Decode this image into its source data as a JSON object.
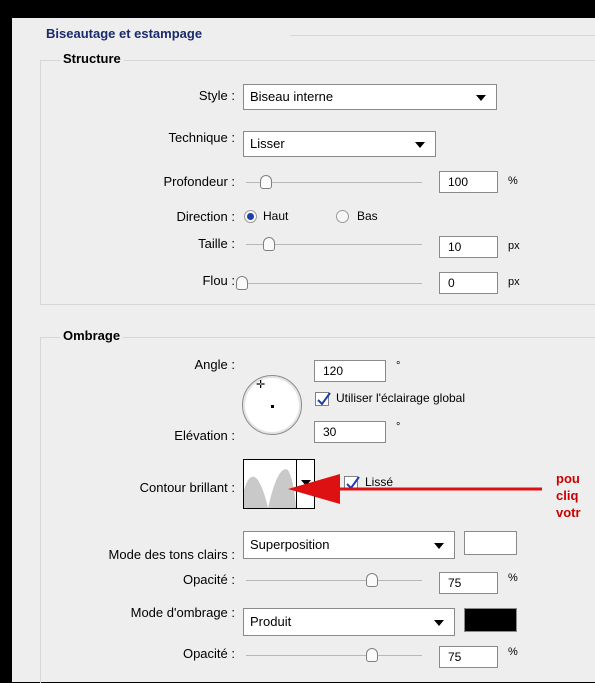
{
  "main_title": "Biseautage et estampage",
  "structure": {
    "title": "Structure",
    "style_label": "Style :",
    "style_value": "Biseau interne",
    "technique_label": "Technique :",
    "technique_value": "Lisser",
    "profondeur_label": "Profondeur :",
    "profondeur_value": "100",
    "profondeur_unit": "%",
    "profondeur_level": 0.08,
    "direction_label": "Direction :",
    "direction_haut": "Haut",
    "direction_bas": "Bas",
    "taille_label": "Taille :",
    "taille_value": "10",
    "taille_unit": "px",
    "taille_level": 0.06,
    "flou_label": "Flou :",
    "flou_value": "0",
    "flou_unit": "px",
    "flou_level": 0.0
  },
  "ombrage": {
    "title": "Ombrage",
    "angle_label": "Angle :",
    "angle_value": "120",
    "angle_unit": "°",
    "global_light_label": "Utiliser l'éclairage global",
    "elevation_label": "Elévation :",
    "elevation_value": "30",
    "elevation_unit": "°",
    "contour_label": "Contour brillant :",
    "lisse_label": "Lissé",
    "mode_clairs_label": "Mode des tons clairs :",
    "mode_clairs_value": "Superposition",
    "highlight_color": "#ffffff",
    "opacite1_label": "Opacité :",
    "opacite1_value": "75",
    "opacite1_unit": "%",
    "opacite1_level": 0.75,
    "mode_ombrage_label": "Mode d'ombrage :",
    "mode_ombrage_value": "Produit",
    "shadow_color": "#000000",
    "opacite2_label": "Opacité :",
    "opacite2_value": "75",
    "opacite2_unit": "%",
    "opacite2_level": 0.75
  },
  "annotation": {
    "line1": "pou",
    "line2": "cliq",
    "line3": "votr",
    "color": "#cc0000"
  }
}
